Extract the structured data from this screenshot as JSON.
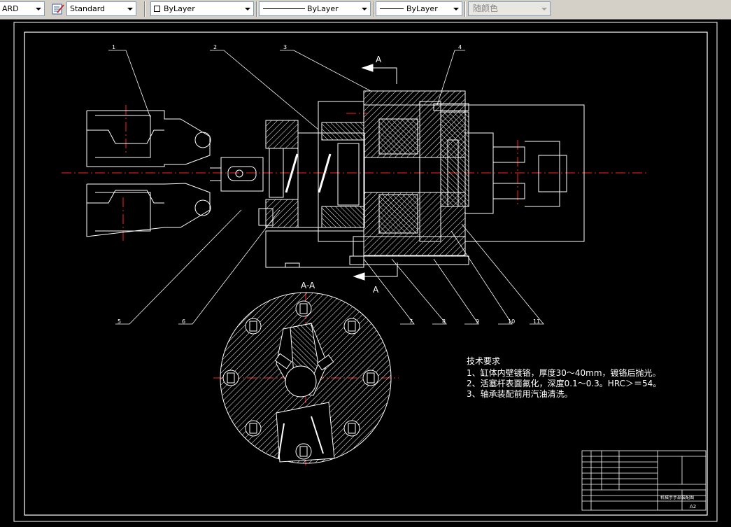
{
  "toolbar": {
    "textstyle_value": "ARD",
    "dimstyle_value": "Standard",
    "layer_value": "ByLayer",
    "linetype_value": "ByLayer",
    "lineweight_value": "ByLayer",
    "color_value": "随颜色"
  },
  "drawing": {
    "section_label_top": "A",
    "section_label_bottom": "A",
    "section_title": "A-A",
    "balloons": [
      "1",
      "2",
      "3",
      "4",
      "5",
      "6",
      "7",
      "8",
      "9",
      "10",
      "11"
    ],
    "notes": {
      "title": "技术要求",
      "lines": [
        "1、缸体内壁镀铬，厚度30～40mm，镀铬后抛光。",
        "2、活塞杆表面氟化，深度0.1～0.3。HRC＞＝54。",
        "3、轴承装配前用汽油清洗。"
      ]
    },
    "title_block": {
      "drawing_name": "机械手手部装配图",
      "sheet_size": "A2"
    }
  },
  "colors": {
    "background": "#000000",
    "lines": "#ffffff",
    "centerlines": "#ff2020",
    "toolbar": "#d4d0c8"
  }
}
